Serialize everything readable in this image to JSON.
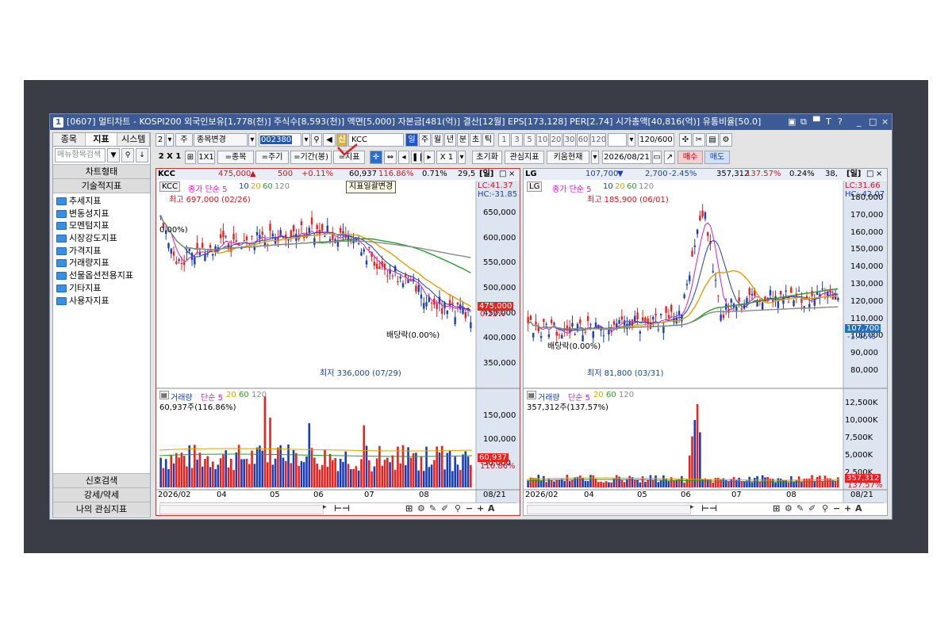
{
  "window": {
    "index": "1",
    "title": "[0607] 멀티차트 - KOSPI200 외국인보유[1,778(천)] 주식수[8,593(천)] 액면[5,000] 자본금[481(억)] 결산[12월] EPS[173,128] PER[2.74] 시가총액[40,816(억)] 유통비율[50.0]",
    "title_buttons": [
      "▣",
      "⧉",
      "▀",
      "T",
      "?",
      "_",
      "□",
      "×"
    ]
  },
  "left_panel": {
    "tabs": [
      "종목",
      "지표",
      "시스템"
    ],
    "active_tab": "지표",
    "search_placeholder": "메뉴항목검색",
    "section_top": "차트형태",
    "section_title": "기술적지표",
    "tree": [
      "추세지표",
      "변동성지표",
      "모멘텀지표",
      "시장강도지표",
      "가격지표",
      "거래량지표",
      "선물옵션전용지표",
      "기타지표",
      "사용자지표"
    ],
    "footer": [
      "신호검색",
      "강세/약세",
      "나의 관심지표"
    ]
  },
  "toolbar1": {
    "sel1": "2",
    "type": "주",
    "change": "종목변경",
    "code": "002380",
    "sin": "신",
    "stock_name": "KCC",
    "periods": [
      "일",
      "주",
      "월",
      "년",
      "분",
      "초",
      "틱"
    ],
    "active_period": "일",
    "mins": [
      "1",
      "3",
      "5",
      "10",
      "20",
      "30",
      "60",
      "120"
    ],
    "count": "120/600"
  },
  "toolbar2": {
    "grid_label": "2 X 1",
    "grid_btn": "1X1",
    "btn_same_stock": "=종목",
    "btn_same_period": "=주기",
    "btn_same_range": "=기간(봉)",
    "btn_indicator": "=지표",
    "zoom": "X 1",
    "btn_reset": "초기화",
    "btn_favorites": "관심지표",
    "btn_kiwoom": "키움현재",
    "date": "2026/08/21",
    "btn_buy": "매수",
    "btn_sell": "매도"
  },
  "tooltip": "지표일괄변경",
  "charts": [
    {
      "name": "KCC",
      "price": "475,000",
      "change": "500",
      "rate": "+0.11%",
      "volume": "60,937",
      "vol_ratio": "116.86%",
      "turnover": "0.71%",
      "extra": "29,5",
      "period_tag": "[일]",
      "legend_name": "KCC",
      "legend": [
        "종가 단순 5",
        "10",
        "20",
        "60",
        "120"
      ],
      "high_label": "최고 697,000 (02/26)",
      "low_label": "최저 336,000 (07/29)",
      "div_label": "배당락(0.00%)",
      "div_label2": "0.00%)",
      "lc": "LC:41.37",
      "hc": "HC:-31.85",
      "price_tag": "475,000",
      "price_tag_rate": "0.32%",
      "y_ticks": [
        "650,000",
        "600,000",
        "550,000",
        "500,000",
        "450,000",
        "400,000",
        "350,000"
      ],
      "vol_legend": [
        "거래량",
        "단순 5",
        "20",
        "60",
        "120"
      ],
      "vol_value": "60,937주(116.86%)",
      "vol_ticks": [
        "150,000",
        "100,000",
        "50,000"
      ],
      "vol_tag": "60,937",
      "vol_tag_rate": "116.86%",
      "x_labels": [
        "2026/02",
        "04",
        "05",
        "06",
        "07",
        "08"
      ],
      "date_tag": "08/21"
    },
    {
      "name": "LG",
      "price": "107,700",
      "change": "2,700",
      "rate": "-2.45%",
      "volume": "357,312",
      "vol_ratio": "137.57%",
      "turnover": "0.24%",
      "extra": "38,",
      "period_tag": "[일]",
      "legend_name": "LG",
      "legend": [
        "종가 단순 5",
        "10",
        "20",
        "60",
        "120"
      ],
      "high_label": "최고 185,900 (06/01)",
      "low_label": "최저 81,800 (03/31)",
      "div_label": "배당락(0.00%)",
      "lc": "LC:31.66",
      "hc": "HC:-42.07",
      "price_tag": "107,700",
      "price_tag_rate": "-1.46%",
      "y_ticks": [
        "180,000",
        "170,000",
        "160,000",
        "150,000",
        "140,000",
        "130,000",
        "120,000",
        "110,000",
        "100,000",
        "90,000",
        "80,000"
      ],
      "vol_legend": [
        "거래량",
        "단순 5",
        "20",
        "60",
        "120"
      ],
      "vol_value": "357,312주(137.57%)",
      "vol_ticks": [
        "12,500K",
        "10,000K",
        "7,500K",
        "5,000K",
        "2,500K"
      ],
      "vol_tag": "357,312",
      "vol_tag_rate": "137.57%",
      "x_labels": [
        "2026/02",
        "04",
        "05",
        "06",
        "07",
        "08"
      ],
      "date_tag": "08/21"
    }
  ],
  "colors": {
    "title_bar": "#3c5a96",
    "up": "#e8231f",
    "down": "#1a3fb5",
    "ma5": "#d020c8",
    "ma10": "#1a3fb5",
    "ma20": "#e0a000",
    "ma60": "#2a9a2a",
    "ma120": "#888888"
  }
}
